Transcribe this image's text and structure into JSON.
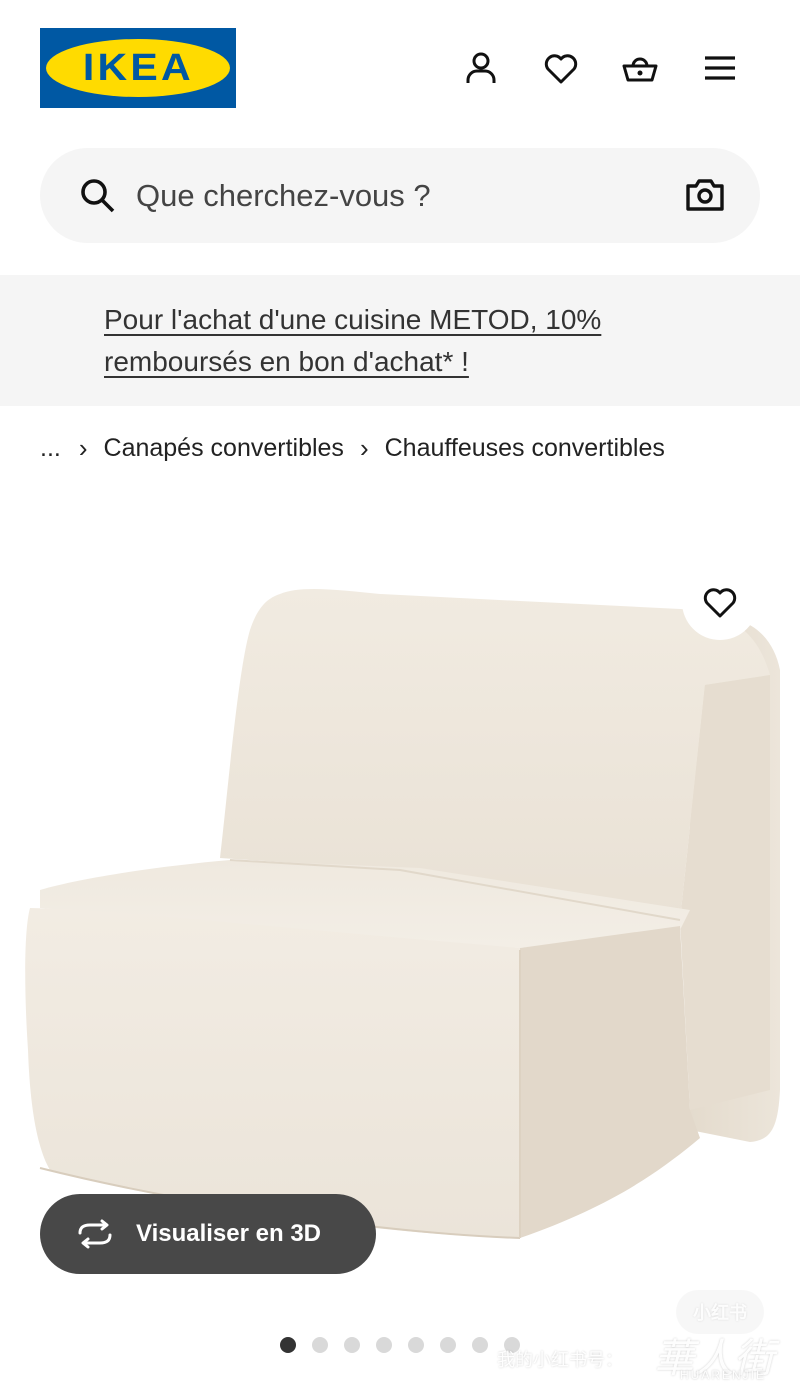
{
  "brand": {
    "logo_text": "IKEA",
    "blue": "#0058a3",
    "yellow": "#ffdb00"
  },
  "header": {
    "icons": [
      "person-icon",
      "heart-icon",
      "shopping-basket-icon",
      "hamburger-menu-icon"
    ]
  },
  "search": {
    "placeholder": "Que cherchez-vous ?"
  },
  "promo": {
    "icon": "tag-icon",
    "text": "Pour l'achat d'une cuisine METOD, 10% remboursés en bon d'achat* !"
  },
  "breadcrumb": {
    "ellipsis": "...",
    "items": [
      "Canapés convertibles",
      "Chauffeuses convertibles"
    ]
  },
  "product": {
    "view_3d_label": "Visualiser en 3D",
    "carousel": {
      "total": 8,
      "active": 1
    }
  },
  "watermark": {
    "badge": "小红书",
    "text": "我的小红书号：",
    "logo_big": "華人街",
    "logo_small": "HUARENJIE"
  }
}
